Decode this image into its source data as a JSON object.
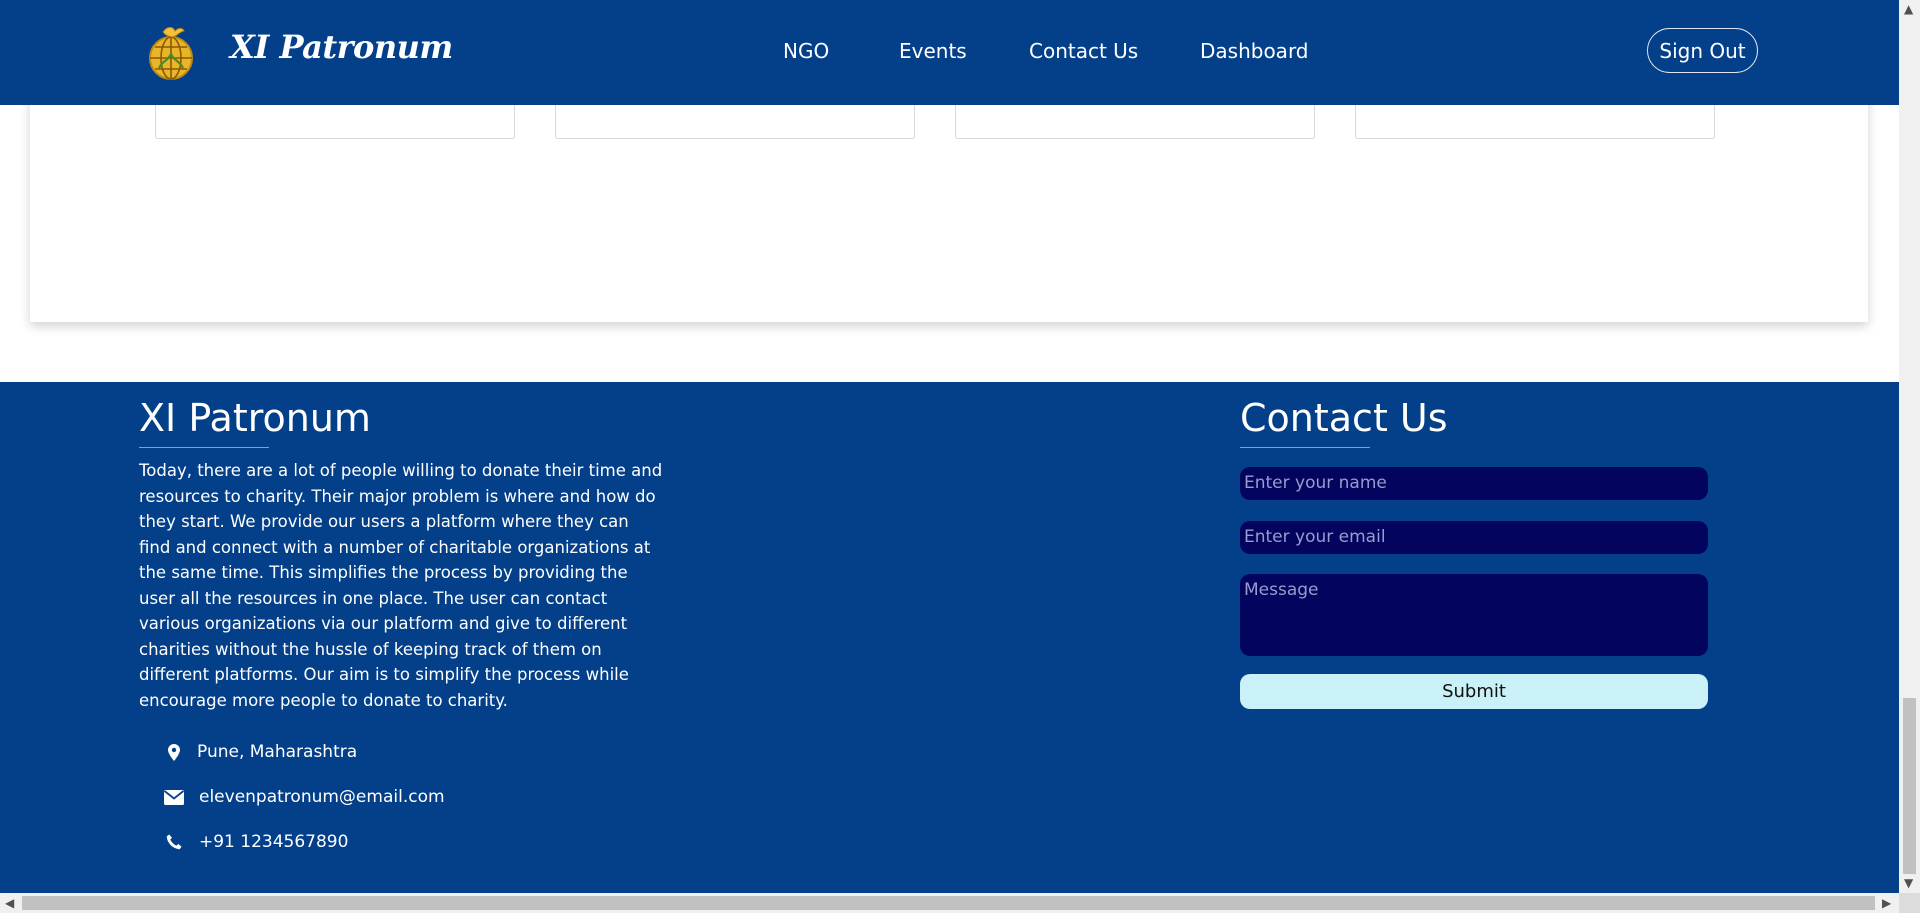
{
  "header": {
    "brand": "XI Patronum",
    "nav": [
      "NGO",
      "Events",
      "Contact Us",
      "Dashboard"
    ],
    "sign_out": "Sign Out"
  },
  "footer": {
    "about_title": "XI Patronum",
    "about_text": "Today, there are a lot of people willing to donate their time and resources to charity. Their major problem is where and how do they start. We provide our users a platform where they can find and connect with a number of charitable organizations at the same time. This simplifies the process by providing the user all the resources in one place. The user can contact various organizations via our platform and give to different charities without the hussle of keeping track of them on different platforms. Our aim is to simplify the process while encourage more people to donate to charity.",
    "location": "Pune, Maharashtra",
    "email": "elevenpatronum@email.com",
    "phone": "+91 1234567890",
    "contact_title": "Contact Us",
    "name_placeholder": "Enter your name",
    "email_placeholder": "Enter your email",
    "message_placeholder": "Message",
    "submit": "Submit"
  },
  "colors": {
    "brand_blue": "#04408a",
    "input_bg": "#03045e",
    "submit_bg": "#caf0f8",
    "accent_underline": "#e58a3a"
  }
}
